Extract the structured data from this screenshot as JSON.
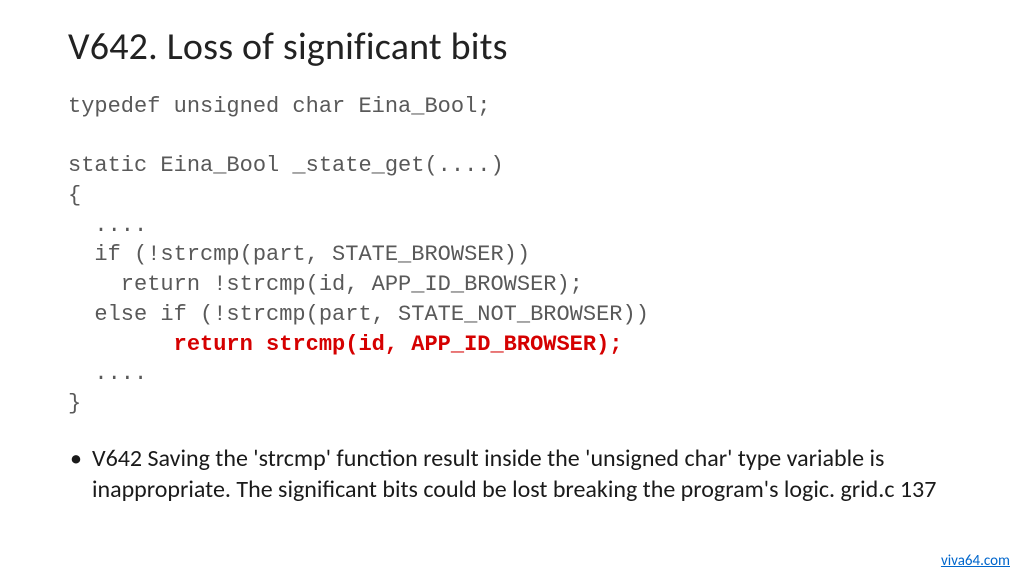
{
  "title": "V642. Loss of significant bits",
  "code": {
    "l1": "typedef unsigned char Eina_Bool;",
    "l2": "",
    "l3": "static Eina_Bool _state_get(....)",
    "l4": "{",
    "l5": "  ....",
    "l6": "  if (!strcmp(part, STATE_BROWSER))",
    "l7": "    return !strcmp(id, APP_ID_BROWSER);",
    "l8": "  else if (!strcmp(part, STATE_NOT_BROWSER))",
    "l9": "    return strcmp(id, APP_ID_BROWSER);",
    "l10": "  ....",
    "l11": "}"
  },
  "bullet_text": "V642 Saving the 'strcmp' function result inside the 'unsigned char' type variable is inappropriate. The significant bits could be lost breaking the program's logic. grid.c 137",
  "footer_link": "viva64.com"
}
